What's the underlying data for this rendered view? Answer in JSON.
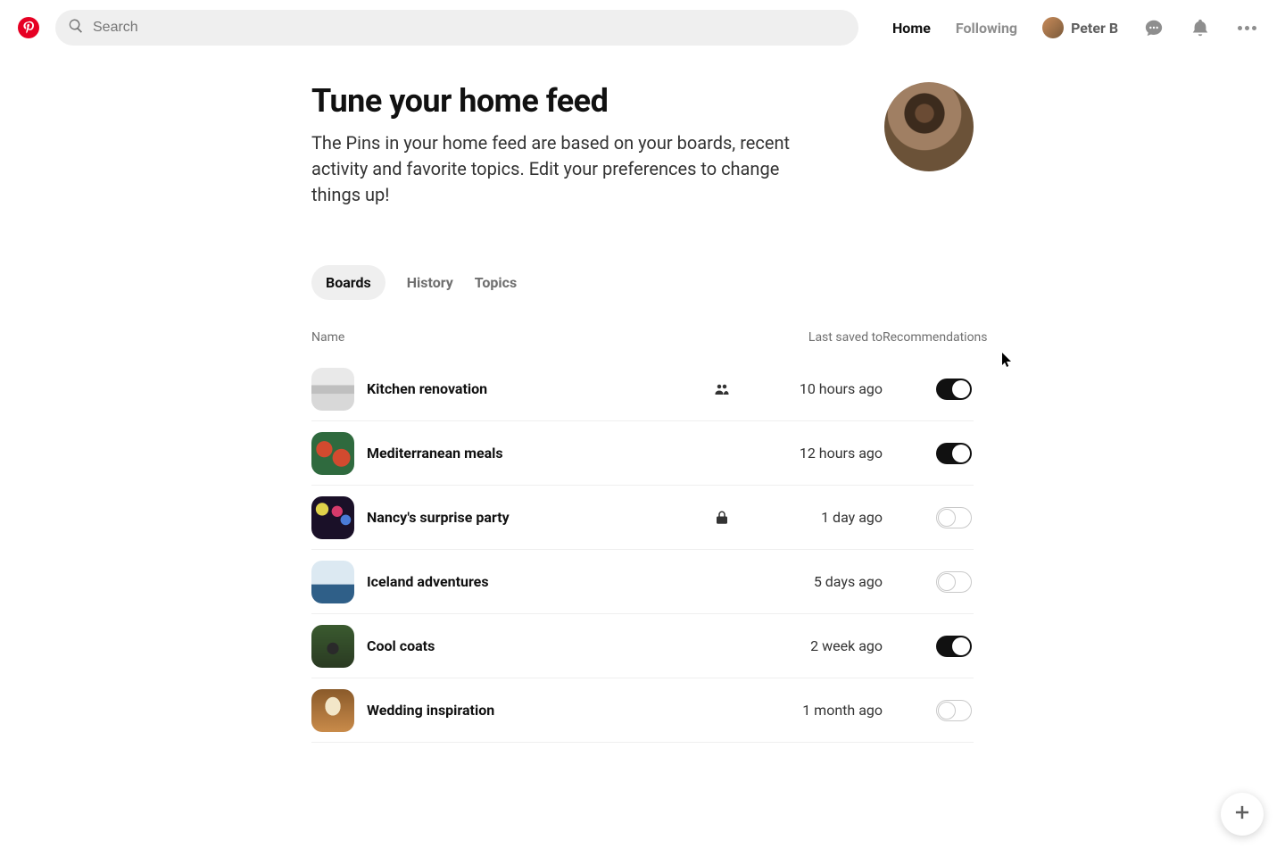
{
  "search": {
    "placeholder": "Search"
  },
  "nav": {
    "home": "Home",
    "following": "Following",
    "user_name": "Peter B"
  },
  "page": {
    "title": "Tune your home feed",
    "subtitle": "The Pins in your home feed are based on your boards, recent activity and favorite topics. Edit your preferences to change things up!"
  },
  "tabs": {
    "boards": "Boards",
    "history": "History",
    "topics": "Topics",
    "active": "boards"
  },
  "columns": {
    "name": "Name",
    "last_saved": "Last saved to",
    "recommendations": "Recommendations"
  },
  "boards": [
    {
      "name": "Kitchen renovation",
      "thumb": "kitchen",
      "badge": "shared",
      "last_saved": "10 hours ago",
      "recommend": true
    },
    {
      "name": "Mediterranean meals",
      "thumb": "medit",
      "badge": "",
      "last_saved": "12 hours ago",
      "recommend": true
    },
    {
      "name": "Nancy's surprise party",
      "thumb": "party",
      "badge": "locked",
      "last_saved": "1 day ago",
      "recommend": false
    },
    {
      "name": "Iceland adventures",
      "thumb": "iceland",
      "badge": "",
      "last_saved": "5 days ago",
      "recommend": false
    },
    {
      "name": "Cool coats",
      "thumb": "coats",
      "badge": "",
      "last_saved": "2 week ago",
      "recommend": true
    },
    {
      "name": "Wedding inspiration",
      "thumb": "wedding",
      "badge": "",
      "last_saved": "1 month ago",
      "recommend": false
    }
  ]
}
